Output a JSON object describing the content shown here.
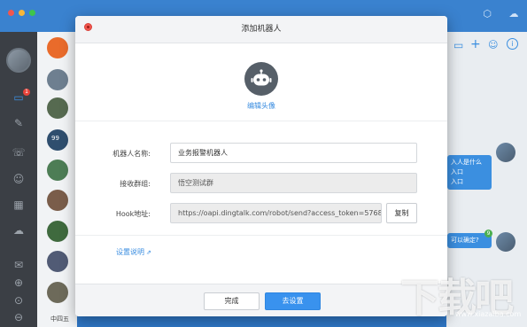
{
  "app": {
    "sidebar_badge": "1",
    "conv_badge": "99",
    "chat_bubble_1": [
      "入人是什么",
      "入口",
      "入口"
    ],
    "chat_bubble_2": "可以确定?",
    "chat_badge": "9",
    "conv_bottom_text": "中四五"
  },
  "modal": {
    "title": "添加机器人",
    "edit_avatar": "编辑头像",
    "name_label": "机器人名称:",
    "name_value": "业务报警机器人",
    "group_label": "接收群组:",
    "group_value": "悟空测试群",
    "hook_label": "Hook地址:",
    "hook_value": "https://oapi.dingtalk.com/robot/send?access_token=5768",
    "copy_label": "复制",
    "settings_link": "设置说明",
    "done_label": "完成",
    "go_settings_label": "去设置"
  },
  "watermark": {
    "text": "下载吧",
    "url": "www.xiazaiba.com"
  },
  "colors": {
    "accent": "#3992ee",
    "link": "#3a8de0",
    "close": "#f2564e",
    "sidebar": "#3b3f45"
  }
}
